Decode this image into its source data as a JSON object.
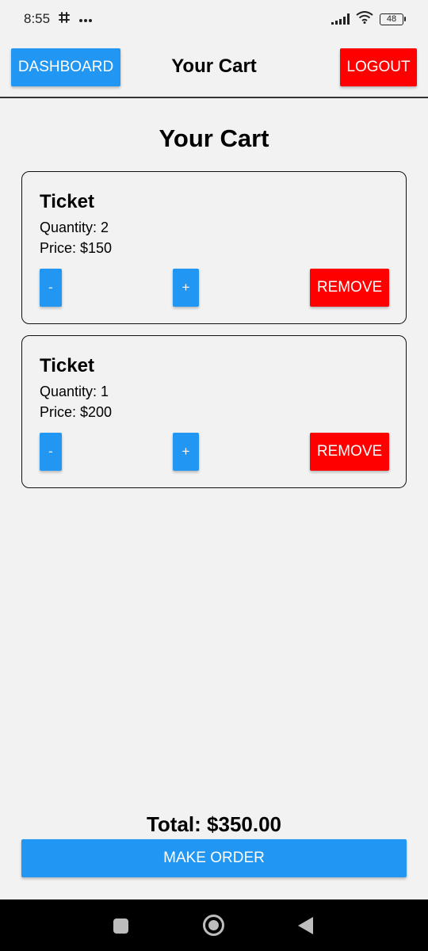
{
  "status_bar": {
    "time": "8:55",
    "notification_icons": [
      "slack-icon",
      "more-icon"
    ],
    "battery_level": "48"
  },
  "header": {
    "dashboard_label": "DASHBOARD",
    "title": "Your Cart",
    "logout_label": "LOGOUT"
  },
  "page": {
    "title": "Your Cart"
  },
  "cart": {
    "items": [
      {
        "name": "Ticket",
        "quantity_text": "Quantity: 2",
        "price_text": "Price: $150",
        "decrement_label": "-",
        "increment_label": "+",
        "remove_label": "REMOVE"
      },
      {
        "name": "Ticket",
        "quantity_text": "Quantity: 1",
        "price_text": "Price: $200",
        "decrement_label": "-",
        "increment_label": "+",
        "remove_label": "REMOVE"
      }
    ],
    "total_text": "Total: $350.00",
    "make_order_label": "MAKE ORDER"
  },
  "colors": {
    "primary": "#2196f3",
    "danger": "#ff0000",
    "background": "#f2f2f2"
  },
  "nav_bar": {
    "icons": [
      "recents-icon",
      "home-icon",
      "back-icon"
    ]
  }
}
